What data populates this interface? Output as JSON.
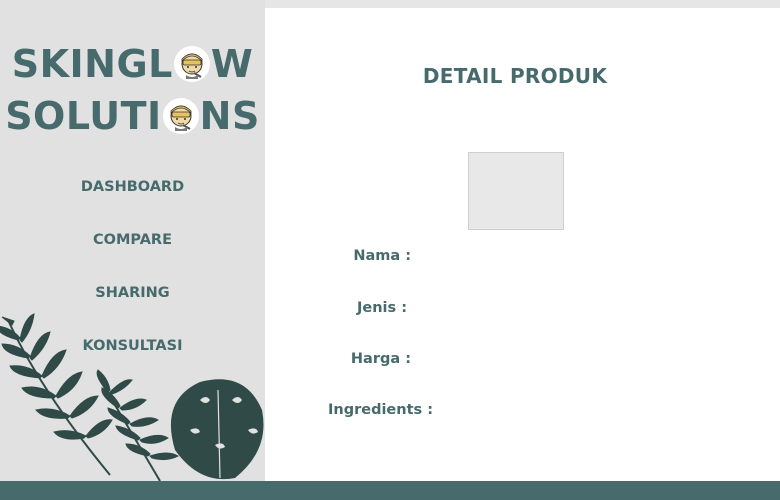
{
  "brand": {
    "line1_before": "SKINGL",
    "line1_after": "W",
    "line2_before": "SOLUTI",
    "line2_after": "NS",
    "logo_icon": "face-mask-icon"
  },
  "nav": {
    "items": [
      {
        "label": "DASHBOARD"
      },
      {
        "label": "COMPARE"
      },
      {
        "label": "SHARING"
      },
      {
        "label": "KONSULTASI"
      }
    ]
  },
  "detail": {
    "title": "DETAIL PRODUK",
    "image_placeholder": "product-image-placeholder",
    "fields": [
      {
        "label": "Nama :"
      },
      {
        "label": "Jenis :"
      },
      {
        "label": "Harga :"
      },
      {
        "label": "Ingredients :"
      }
    ]
  },
  "colors": {
    "accent": "#476a6c",
    "sidebar_bg": "#e1e1e1",
    "leaf_dark": "#2f4a47",
    "leaf_mid": "#3d5e5a"
  }
}
